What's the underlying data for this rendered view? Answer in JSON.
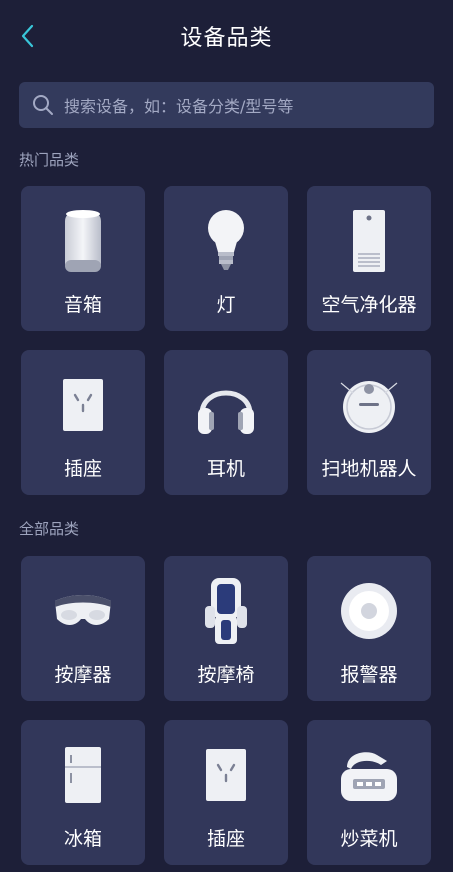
{
  "header": {
    "title": "设备品类",
    "back_icon": "chevron-left-icon"
  },
  "search": {
    "placeholder": "搜索设备，如：设备分类/型号等",
    "icon": "search-icon"
  },
  "hot": {
    "title": "热门品类",
    "items": [
      {
        "label": "音箱",
        "icon": "speaker-icon"
      },
      {
        "label": "灯",
        "icon": "lightbulb-icon"
      },
      {
        "label": "空气净化器",
        "icon": "air-purifier-icon"
      },
      {
        "label": "插座",
        "icon": "socket-icon"
      },
      {
        "label": "耳机",
        "icon": "headphones-icon"
      },
      {
        "label": "扫地机器人",
        "icon": "robot-vacuum-icon"
      }
    ]
  },
  "all": {
    "title": "全部品类",
    "items": [
      {
        "label": "按摩器",
        "icon": "eye-massager-icon"
      },
      {
        "label": "按摩椅",
        "icon": "massage-chair-icon"
      },
      {
        "label": "报警器",
        "icon": "alarm-icon"
      },
      {
        "label": "冰箱",
        "icon": "fridge-icon"
      },
      {
        "label": "插座",
        "icon": "socket-icon"
      },
      {
        "label": "炒菜机",
        "icon": "cooking-machine-icon"
      }
    ]
  },
  "colors": {
    "background": "#1d1f38",
    "card": "#32375a",
    "search": "#333a5c",
    "accent": "#39c6d9"
  }
}
